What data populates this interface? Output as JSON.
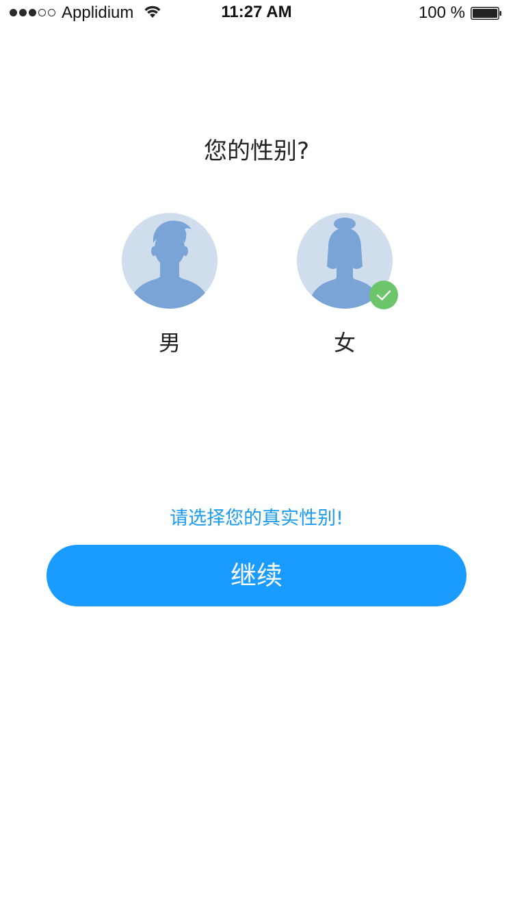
{
  "status_bar": {
    "carrier": "Applidium",
    "time": "11:27 AM",
    "battery": "100 %",
    "signal_filled": 3,
    "signal_total": 5
  },
  "question": "您的性别?",
  "options": [
    {
      "label": "男",
      "icon": "male-avatar-icon",
      "selected": false
    },
    {
      "label": "女",
      "icon": "female-avatar-icon",
      "selected": true
    }
  ],
  "hint": "请选择您的真实性别!",
  "continue_label": "继续",
  "colors": {
    "accent": "#1a9bff",
    "hint": "#1a9bf0",
    "avatar_bg": "#d0ddec",
    "avatar_fg": "#7aa3d6",
    "selected_badge": "#6cc56a"
  }
}
